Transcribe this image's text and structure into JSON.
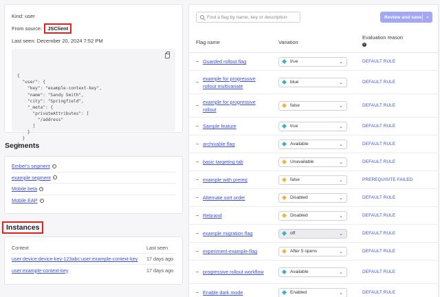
{
  "context": {
    "kind_label": "Kind: user",
    "source_prefix": "From source:",
    "source_value": "JSClient",
    "last_seen": "Last seen: December 20, 2024 7:52 PM",
    "json_lines": [
      "{",
      "  \"user\": {",
      "    \"key\": \"example-context-key\",",
      "    \"name\": \"Sandy Smith\",",
      "    \"city\": \"Springfield\",",
      "    \"_meta\": {",
      "      \"privateAttributes\": [",
      "        \"/address\"",
      "      ]",
      "    }",
      "  }",
      "}"
    ]
  },
  "segments": {
    "title": "Segments",
    "items": [
      "Ember's segment",
      "example segment",
      "Mobile beta",
      "Mobile EAP"
    ]
  },
  "instances": {
    "title": "Instances",
    "col_context": "Context",
    "col_last_seen": "Last seen",
    "rows": [
      {
        "context": "user:device:device-key-123abc:user:example-context-key",
        "last_seen": "17 days ago"
      },
      {
        "context": "user:example-context-key",
        "last_seen": "17 days ago"
      }
    ]
  },
  "flags_panel": {
    "search_placeholder": "Find a flag by name, key or description",
    "review_button": "Review and save",
    "col_flag_name": "Flag name",
    "col_variation": "Variation",
    "col_reason_line1": "Evaluation reason",
    "colors": {
      "teal": "#3bb0c9",
      "amber": "#f2b533",
      "accent": "#a3a7f5",
      "link": "#3b4fd8"
    },
    "rows": [
      {
        "name": "Guarded rollout flag",
        "variation": "true",
        "color": "#3bb0c9",
        "reason": "DEFAULT RULE",
        "lines": 1,
        "disabled": false
      },
      {
        "name": "example for progressive rollout multivariate",
        "variation": "blue",
        "color": "#3bb0c9",
        "reason": "DEFAULT RULE",
        "lines": 2,
        "disabled": false
      },
      {
        "name": "example for progressive rollout",
        "variation": "false",
        "color": "#f2b533",
        "reason": "DEFAULT RULE",
        "lines": 2,
        "disabled": false
      },
      {
        "name": "Sample feature",
        "variation": "true",
        "color": "#3bb0c9",
        "reason": "DEFAULT RULE",
        "lines": 1,
        "disabled": false
      },
      {
        "name": "archivable flag",
        "variation": "Available",
        "color": "#3bb0c9",
        "reason": "DEFAULT RULE",
        "lines": 1,
        "disabled": false
      },
      {
        "name": "basic targeting tab",
        "variation": "Unavailable",
        "color": "#f2b533",
        "reason": "DEFAULT RULE",
        "lines": 1,
        "disabled": false
      },
      {
        "name": "example with prereq",
        "variation": "false",
        "color": "#f2b533",
        "reason": "PREREQUISITE FAILED",
        "lines": 1,
        "disabled": false
      },
      {
        "name": "Alternate sort order",
        "variation": "Disabled",
        "color": "#f2b533",
        "reason": "DEFAULT RULE",
        "lines": 1,
        "disabled": false
      },
      {
        "name": "Rebrand",
        "variation": "Disabled",
        "color": "#f2b533",
        "reason": "DEFAULT RULE",
        "lines": 1,
        "disabled": false
      },
      {
        "name": "example migration flag",
        "variation": "off",
        "color": "#3bb0c9",
        "reason": "DEFAULT RULE",
        "lines": 1,
        "disabled": true
      },
      {
        "name": "experiment-example-flag",
        "variation": "After 5 opens",
        "color": "#f2b533",
        "reason": "DEFAULT RULE",
        "lines": 1,
        "disabled": false
      },
      {
        "name": "progressive rollout workflow",
        "variation": "Available",
        "color": "#3bb0c9",
        "reason": "DEFAULT RULE",
        "lines": 2,
        "disabled": false
      },
      {
        "name": "Enable dark mode",
        "variation": "Enabled",
        "color": "#3bb0c9",
        "reason": "DEFAULT RULE",
        "lines": 1,
        "disabled": false
      }
    ]
  }
}
